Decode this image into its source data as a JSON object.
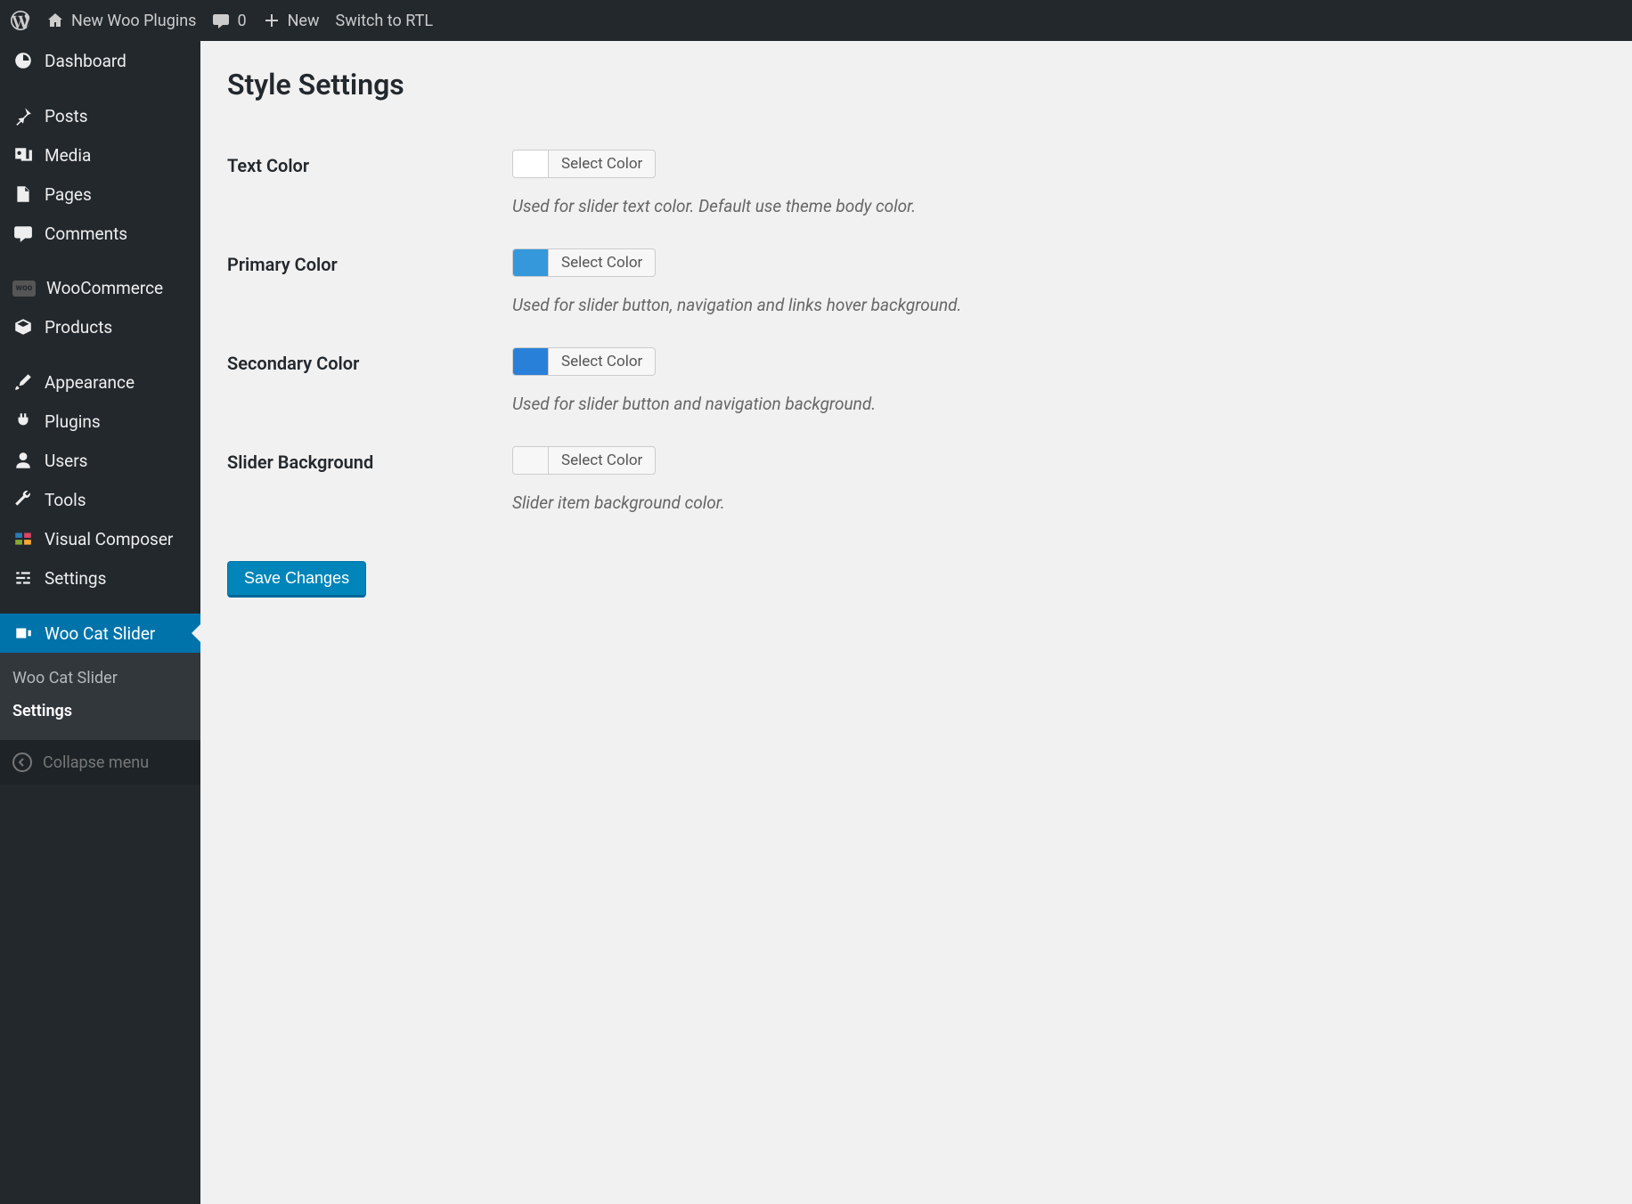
{
  "adminbar": {
    "site_name": "New Woo Plugins",
    "comments_count": "0",
    "new_label": "New",
    "rtl_label": "Switch to RTL"
  },
  "sidebar": {
    "items": [
      {
        "label": "Dashboard"
      },
      {
        "label": "Posts"
      },
      {
        "label": "Media"
      },
      {
        "label": "Pages"
      },
      {
        "label": "Comments"
      },
      {
        "label": "WooCommerce"
      },
      {
        "label": "Products"
      },
      {
        "label": "Appearance"
      },
      {
        "label": "Plugins"
      },
      {
        "label": "Users"
      },
      {
        "label": "Tools"
      },
      {
        "label": "Visual Composer"
      },
      {
        "label": "Settings"
      },
      {
        "label": "Woo Cat Slider"
      }
    ],
    "submenu": [
      {
        "label": "Woo Cat Slider"
      },
      {
        "label": "Settings"
      }
    ],
    "collapse_label": "Collapse menu"
  },
  "page": {
    "title": "Style Settings",
    "rows": [
      {
        "label": "Text Color",
        "swatch": "#ffffff",
        "button": "Select Color",
        "desc": "Used for slider text color. Default use theme body color."
      },
      {
        "label": "Primary Color",
        "swatch": "#3498db",
        "button": "Select Color",
        "desc": "Used for slider button, navigation and links hover background."
      },
      {
        "label": "Secondary Color",
        "swatch": "#2980d9",
        "button": "Select Color",
        "desc": "Used for slider button and navigation background."
      },
      {
        "label": "Slider Background",
        "swatch": "#f7f7f7",
        "button": "Select Color",
        "desc": "Slider item background color."
      }
    ],
    "save_label": "Save Changes"
  }
}
